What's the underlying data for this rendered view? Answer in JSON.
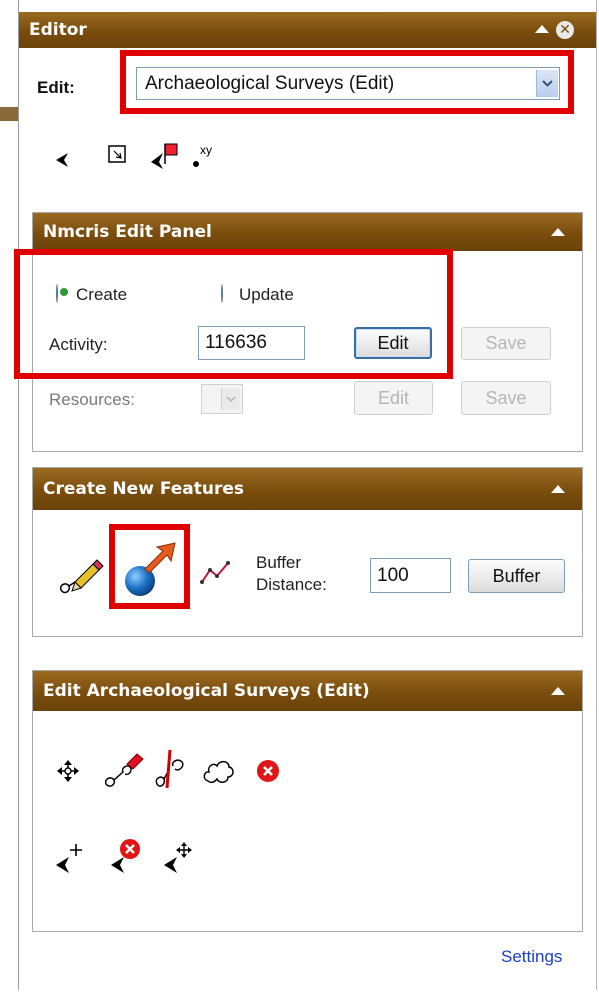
{
  "editor": {
    "title": "Editor",
    "edit_label": "Edit:",
    "layer_selected": "Archaeological Surveys (Edit)"
  },
  "nmcris": {
    "title": "Nmcris Edit Panel",
    "radio_create": "Create",
    "radio_update": "Update",
    "selected_mode": "Create",
    "activity_label": "Activity:",
    "activity_value": "116636",
    "edit_button": "Edit",
    "save_button": "Save",
    "resources_label": "Resources:",
    "resources_edit": "Edit",
    "resources_save": "Save"
  },
  "create": {
    "title": "Create New Features",
    "buffer_label_line1": "Buffer",
    "buffer_label_line2": "Distance:",
    "buffer_value": "100",
    "buffer_button": "Buffer"
  },
  "edit_surveys": {
    "title": "Edit Archaeological Surveys (Edit)"
  },
  "footer": {
    "settings_link": "Settings"
  },
  "colors": {
    "header_brown": "#7a4d0e",
    "highlight_red": "#e10000",
    "link_blue": "#1a3fc7"
  },
  "xy_label": "xy"
}
